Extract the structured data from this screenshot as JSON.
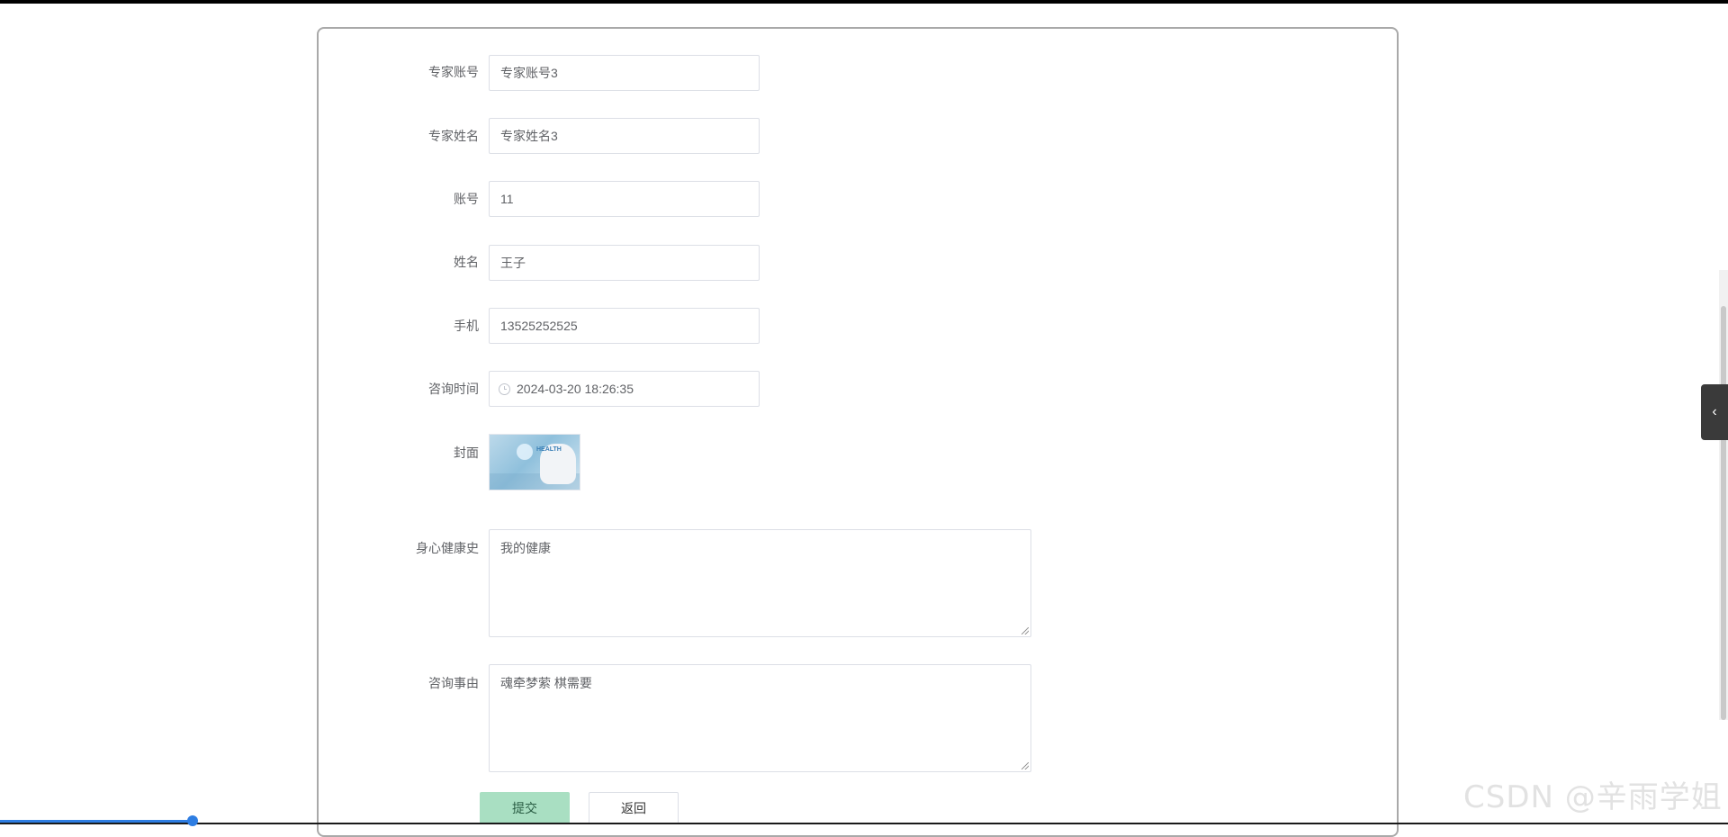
{
  "form": {
    "fields": [
      {
        "label": "专家账号",
        "value": "专家账号3"
      },
      {
        "label": "专家姓名",
        "value": "专家姓名3"
      },
      {
        "label": "账号",
        "value": "11"
      },
      {
        "label": "姓名",
        "value": "王子"
      },
      {
        "label": "手机",
        "value": "13525252525"
      },
      {
        "label": "咨询时间",
        "value": "2024-03-20 18:26:35"
      }
    ],
    "cover": {
      "label": "封面",
      "image_text": "HEALTH"
    },
    "history": {
      "label": "身心健康史",
      "value": "我的健康"
    },
    "reason": {
      "label": "咨询事由",
      "value": "魂牵梦萦  棋需要"
    },
    "submit_label": "提交",
    "back_label": "返回"
  },
  "side_toggle_icon": "chevron-left-icon",
  "watermark": "CSDN @辛雨学姐"
}
